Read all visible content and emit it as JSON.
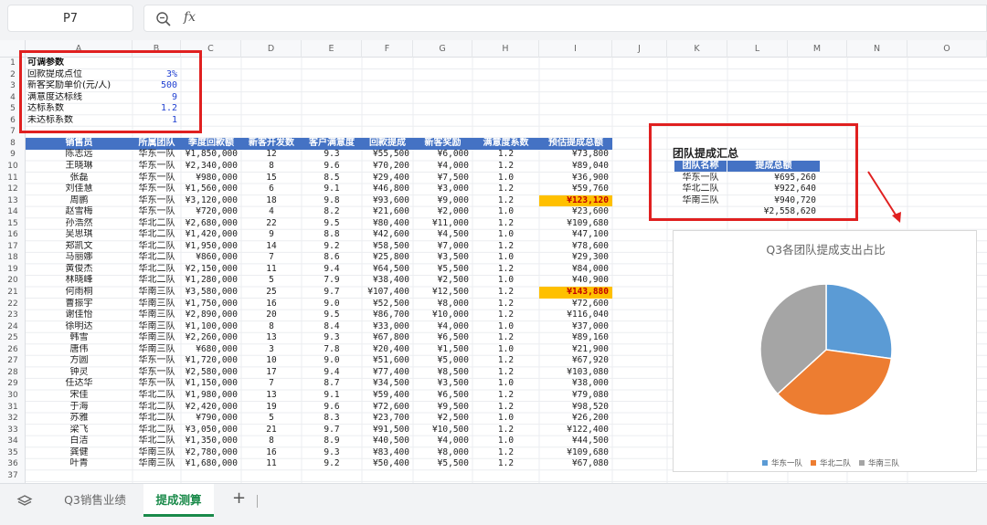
{
  "formula_bar": {
    "cell_ref": "P7",
    "fx_label": "fx"
  },
  "columns": [
    "A",
    "B",
    "C",
    "D",
    "E",
    "F",
    "G",
    "H",
    "I",
    "J",
    "K",
    "L",
    "M",
    "N",
    "O"
  ],
  "rows": [
    "1",
    "2",
    "3",
    "4",
    "5",
    "6",
    "7",
    "8",
    "9",
    "10",
    "11",
    "12",
    "13",
    "14",
    "15",
    "16",
    "17",
    "18",
    "19",
    "20",
    "21",
    "22",
    "23",
    "24",
    "25",
    "26",
    "27",
    "28",
    "29",
    "30",
    "31",
    "32",
    "33",
    "34",
    "35",
    "36",
    "37"
  ],
  "params": {
    "title": "可调参数",
    "items": [
      {
        "label": "回款提成点位",
        "value": "3%"
      },
      {
        "label": "新客奖励单价(元/人)",
        "value": "500"
      },
      {
        "label": "满意度达标线",
        "value": "9"
      },
      {
        "label": "达标系数",
        "value": "1.2"
      },
      {
        "label": "未达标系数",
        "value": "1"
      }
    ]
  },
  "table": {
    "headers": [
      "销售员",
      "所属团队",
      "季度回款额",
      "新客开发数",
      "客户满意度",
      "回款提成",
      "新客奖励",
      "满意度系数",
      "预估提成总额"
    ],
    "rows": [
      [
        "陈志远",
        "华东一队",
        "¥1,850,000",
        "12",
        "9.3",
        "¥55,500",
        "¥6,000",
        "1.2",
        "¥73,800"
      ],
      [
        "王晓琳",
        "华东一队",
        "¥2,340,000",
        "8",
        "9.6",
        "¥70,200",
        "¥4,000",
        "1.2",
        "¥89,040"
      ],
      [
        "张磊",
        "华东一队",
        "¥980,000",
        "15",
        "8.5",
        "¥29,400",
        "¥7,500",
        "1.0",
        "¥36,900"
      ],
      [
        "刘佳慧",
        "华东一队",
        "¥1,560,000",
        "6",
        "9.1",
        "¥46,800",
        "¥3,000",
        "1.2",
        "¥59,760"
      ],
      [
        "周鹏",
        "华东一队",
        "¥3,120,000",
        "18",
        "9.8",
        "¥93,600",
        "¥9,000",
        "1.2",
        "¥123,120"
      ],
      [
        "赵雪梅",
        "华东一队",
        "¥720,000",
        "4",
        "8.2",
        "¥21,600",
        "¥2,000",
        "1.0",
        "¥23,600"
      ],
      [
        "孙浩然",
        "华北二队",
        "¥2,680,000",
        "22",
        "9.5",
        "¥80,400",
        "¥11,000",
        "1.2",
        "¥109,680"
      ],
      [
        "吴思琪",
        "华北二队",
        "¥1,420,000",
        "9",
        "8.8",
        "¥42,600",
        "¥4,500",
        "1.0",
        "¥47,100"
      ],
      [
        "郑凯文",
        "华北二队",
        "¥1,950,000",
        "14",
        "9.2",
        "¥58,500",
        "¥7,000",
        "1.2",
        "¥78,600"
      ],
      [
        "马丽娜",
        "华北二队",
        "¥860,000",
        "7",
        "8.6",
        "¥25,800",
        "¥3,500",
        "1.0",
        "¥29,300"
      ],
      [
        "黄俊杰",
        "华北二队",
        "¥2,150,000",
        "11",
        "9.4",
        "¥64,500",
        "¥5,500",
        "1.2",
        "¥84,000"
      ],
      [
        "林晓峰",
        "华北二队",
        "¥1,280,000",
        "5",
        "7.9",
        "¥38,400",
        "¥2,500",
        "1.0",
        "¥40,900"
      ],
      [
        "何雨桐",
        "华南三队",
        "¥3,580,000",
        "25",
        "9.7",
        "¥107,400",
        "¥12,500",
        "1.2",
        "¥143,880"
      ],
      [
        "曹振宇",
        "华南三队",
        "¥1,750,000",
        "16",
        "9.0",
        "¥52,500",
        "¥8,000",
        "1.2",
        "¥72,600"
      ],
      [
        "谢佳怡",
        "华南三队",
        "¥2,890,000",
        "20",
        "9.5",
        "¥86,700",
        "¥10,000",
        "1.2",
        "¥116,040"
      ],
      [
        "徐明达",
        "华南三队",
        "¥1,100,000",
        "8",
        "8.4",
        "¥33,000",
        "¥4,000",
        "1.0",
        "¥37,000"
      ],
      [
        "韩雪",
        "华南三队",
        "¥2,260,000",
        "13",
        "9.3",
        "¥67,800",
        "¥6,500",
        "1.2",
        "¥89,160"
      ],
      [
        "唐伟",
        "华南三队",
        "¥680,000",
        "3",
        "7.8",
        "¥20,400",
        "¥1,500",
        "1.0",
        "¥21,900"
      ],
      [
        "方圆",
        "华东一队",
        "¥1,720,000",
        "10",
        "9.0",
        "¥51,600",
        "¥5,000",
        "1.2",
        "¥67,920"
      ],
      [
        "钟灵",
        "华东一队",
        "¥2,580,000",
        "17",
        "9.4",
        "¥77,400",
        "¥8,500",
        "1.2",
        "¥103,080"
      ],
      [
        "任达华",
        "华东一队",
        "¥1,150,000",
        "7",
        "8.7",
        "¥34,500",
        "¥3,500",
        "1.0",
        "¥38,000"
      ],
      [
        "宋佳",
        "华北二队",
        "¥1,980,000",
        "13",
        "9.1",
        "¥59,400",
        "¥6,500",
        "1.2",
        "¥79,080"
      ],
      [
        "于海",
        "华北二队",
        "¥2,420,000",
        "19",
        "9.6",
        "¥72,600",
        "¥9,500",
        "1.2",
        "¥98,520"
      ],
      [
        "苏雅",
        "华北二队",
        "¥790,000",
        "5",
        "8.3",
        "¥23,700",
        "¥2,500",
        "1.0",
        "¥26,200"
      ],
      [
        "梁飞",
        "华北二队",
        "¥3,050,000",
        "21",
        "9.7",
        "¥91,500",
        "¥10,500",
        "1.2",
        "¥122,400"
      ],
      [
        "白洁",
        "华北二队",
        "¥1,350,000",
        "8",
        "8.9",
        "¥40,500",
        "¥4,000",
        "1.0",
        "¥44,500"
      ],
      [
        "龚健",
        "华南三队",
        "¥2,780,000",
        "16",
        "9.3",
        "¥83,400",
        "¥8,000",
        "1.2",
        "¥109,680"
      ],
      [
        "叶青",
        "华南三队",
        "¥1,680,000",
        "11",
        "9.2",
        "¥50,400",
        "¥5,500",
        "1.2",
        "¥67,080"
      ]
    ],
    "highlighted_rows": [
      4,
      12
    ]
  },
  "summary": {
    "title": "团队提成汇总",
    "headers": [
      "团队名称",
      "提成总额"
    ],
    "rows": [
      [
        "华东一队",
        "¥695,260"
      ],
      [
        "华北二队",
        "¥922,640"
      ],
      [
        "华南三队",
        "¥940,720"
      ]
    ],
    "total": "¥2,558,620"
  },
  "chart_data": {
    "type": "pie",
    "title": "Q3各团队提成支出占比",
    "categories": [
      "华东一队",
      "华北二队",
      "华南三队"
    ],
    "values": [
      695260,
      922640,
      940720
    ],
    "colors": [
      "#5b9bd5",
      "#ed7d31",
      "#a5a5a5"
    ],
    "legend": "bottom"
  },
  "tabs": {
    "items": [
      "Q3销售业绩",
      "提成测算"
    ],
    "active": "提成测算",
    "add_label": "+"
  }
}
